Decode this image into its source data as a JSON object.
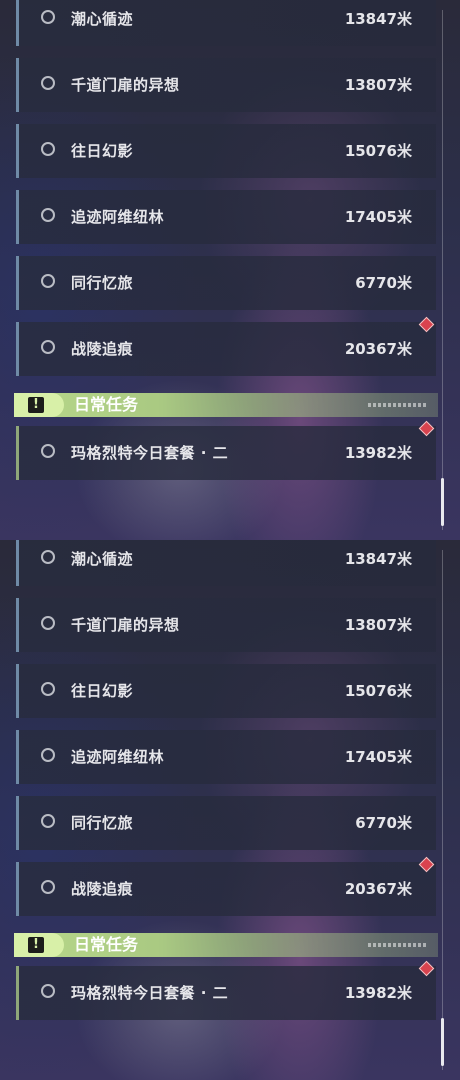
{
  "quests": [
    {
      "name": "潮心循迹",
      "distance": "13847米"
    },
    {
      "name": "千道门扉的异想",
      "distance": "13807米"
    },
    {
      "name": "往日幻影",
      "distance": "15076米"
    },
    {
      "name": "追迹阿维纽林",
      "distance": "17405米"
    },
    {
      "name": "同行忆旅",
      "distance": "6770米"
    },
    {
      "name": "战陵追痕",
      "distance": "20367米"
    }
  ],
  "daily_section": {
    "title": "日常任务",
    "icon": "exclamation-icon",
    "quest": {
      "name": "玛格烈特今日套餐 · 二",
      "distance": "13982米"
    }
  },
  "colors": {
    "section_accent": "#b8d88a",
    "marker": "#d8434f",
    "row_border": "#6f8aa6"
  }
}
